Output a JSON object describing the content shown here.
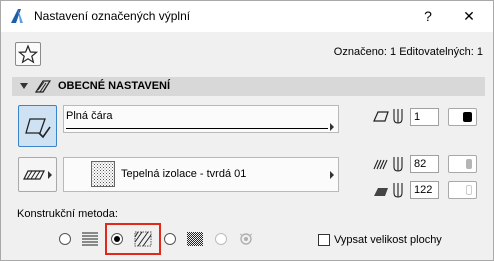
{
  "window": {
    "title": "Nastavení označených výplní",
    "help_label": "?",
    "close_label": "✕"
  },
  "toolbar": {
    "favorites_icon": "star-icon",
    "selection_status": "Označeno: 1 Editovatelných: 1"
  },
  "section": {
    "title": "OBECNÉ NASTAVENÍ",
    "icon": "hatch-section-icon"
  },
  "line": {
    "type_icon": "fill-outline-check-icon",
    "name": "Plná čára",
    "pen_icon": "outline-pen-icon",
    "pen_number": "1",
    "swatch_color": "#000000"
  },
  "fill": {
    "type_icon": "cut-fill-icon",
    "name": "Tepelná izolace - tvrdá 01",
    "foreground_pen_icon": "foreground-pen-icon",
    "foreground_pen": "82",
    "foreground_color": "#b5b5b5",
    "background_pen_icon": "background-pen-icon",
    "background_pen": "122",
    "background_color": "#ffffff"
  },
  "construction": {
    "label": "Konstrukční metoda:",
    "options": [
      {
        "icon": "horizontal-lines-icon",
        "selected": false,
        "enabled": true
      },
      {
        "icon": "diagonal-hatch-icon",
        "selected": true,
        "enabled": true
      },
      {
        "icon": "checker-pattern-icon",
        "selected": false,
        "enabled": true
      },
      {
        "icon": "symbol-fill-icon",
        "selected": false,
        "enabled": false
      }
    ]
  },
  "show_area": {
    "label": "Vypsat velikost plochy",
    "checked": false
  }
}
